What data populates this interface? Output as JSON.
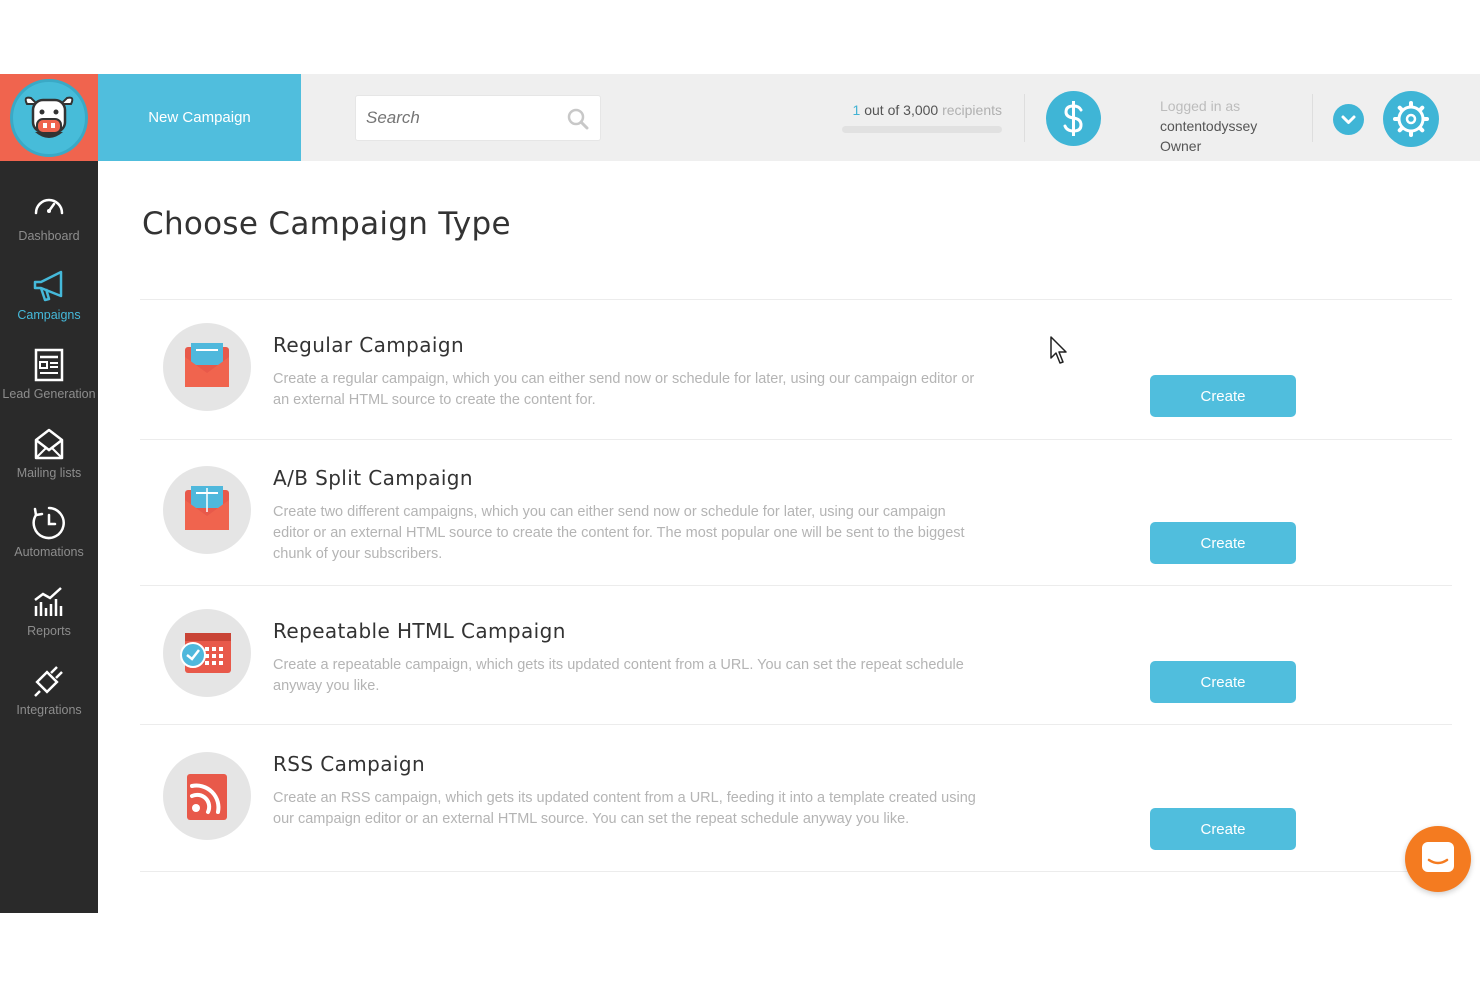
{
  "header": {
    "new_campaign_label": "New Campaign",
    "search_placeholder": "Search",
    "recipients": {
      "used": "1",
      "text": "out of 3,000",
      "unit": "recipients",
      "progress_fraction": 0.0003
    },
    "user": {
      "logged_in_label": "Logged in as",
      "username": "contentodyssey",
      "role": "Owner"
    },
    "accent_color": "#50bedd",
    "logo_bg_color": "#f0644e"
  },
  "sidebar": {
    "items": [
      {
        "label": "Dashboard",
        "icon": "speedometer-icon"
      },
      {
        "label": "Campaigns",
        "icon": "megaphone-icon",
        "active": true
      },
      {
        "label": "Lead Generation",
        "icon": "form-icon"
      },
      {
        "label": "Mailing lists",
        "icon": "envelope-icon"
      },
      {
        "label": "Automations",
        "icon": "clock-icon"
      },
      {
        "label": "Reports",
        "icon": "chart-icon"
      },
      {
        "label": "Integrations",
        "icon": "plug-icon"
      }
    ]
  },
  "main": {
    "title": "Choose Campaign Type",
    "campaigns": [
      {
        "title": "Regular Campaign",
        "description": "Create a regular campaign, which you can either send now or schedule for later, using our campaign editor or an external HTML source to create the content for.",
        "button": "Create",
        "icon": "envelope-icon"
      },
      {
        "title": "A/B Split Campaign",
        "description": "Create two different campaigns, which you can either send now or schedule for later, using our campaign editor or an external HTML source to create the content for. The most popular one will be sent to the biggest chunk of your subscribers.",
        "button": "Create",
        "icon": "split-envelope-icon"
      },
      {
        "title": "Repeatable HTML Campaign",
        "description": "Create a repeatable campaign, which gets its updated content from a URL. You can set the repeat schedule anyway you like.",
        "button": "Create",
        "icon": "calendar-icon"
      },
      {
        "title": "RSS Campaign",
        "description": "Create an RSS campaign, which gets its updated content from a URL, feeding it into a template created using our campaign editor or an external HTML source. You can set the repeat schedule anyway you like.",
        "button": "Create",
        "icon": "rss-icon"
      }
    ]
  }
}
